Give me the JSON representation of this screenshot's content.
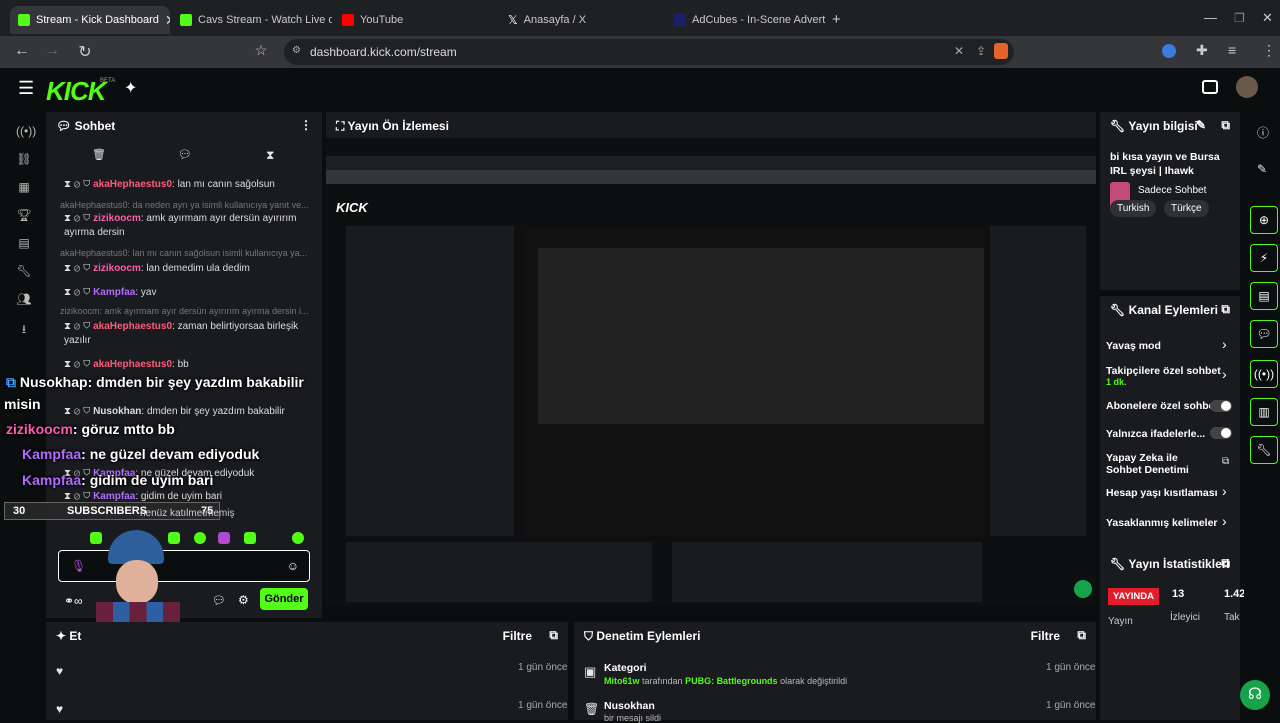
{
  "browser": {
    "tabs": [
      {
        "title": "Stream - Kick Dashboard",
        "color": "#53fc18"
      },
      {
        "title": "Cavs Stream - Watch Live on Kick",
        "color": "#53fc18"
      },
      {
        "title": "YouTube",
        "color": "#ff0000"
      },
      {
        "title": "Anasayfa / X",
        "color": "#ffffff"
      },
      {
        "title": "AdCubes - In-Scene Advertising Platf",
        "color": "#3b4cff"
      }
    ],
    "url": "dashboard.kick.com/stream"
  },
  "kick": {
    "logo": "KICK",
    "beta": "BETA"
  },
  "chat": {
    "title": "Sohbet",
    "messages": [
      {
        "user": "akaHephaestus0",
        "text": ": lan mı canın sağolsun",
        "color": "#ff5b7a"
      },
      {
        "reply": "akaHephaestus0: da neden ayrı ya isimli kullanıcıya yanıt ve..."
      },
      {
        "user": "zizikoocm",
        "text": ": amk ayırmam ayır dersün ayırırım ayırma dersin",
        "color": "#ff5bb0"
      },
      {
        "reply": "akaHephaestus0: lan mı canın sağolsun isimli kullanıcıya ya..."
      },
      {
        "user": "zizikoocm",
        "text": ": lan demedim ula dedim",
        "color": "#ff5bb0"
      },
      {
        "user": "Kampfaa",
        "text": ": yav",
        "color": "#b26bff"
      },
      {
        "reply": "zizikoocm: amk ayırmam ayır dersün ayırırım ayırma dersin i..."
      },
      {
        "user": "akaHephaestus0",
        "text": ": zaman belirtiyorsaa birleşik yazılır",
        "color": "#ff5b7a"
      },
      {
        "user": "akaHephaestus0",
        "text": ": bb",
        "color": "#ff5b7a"
      },
      {
        "user": "Nusokhan",
        "text": ": dmden bir şey yazdım bakabilir",
        "color": "#ffffff"
      },
      {
        "user": "Kampfaa",
        "text": ": ne güzel devam ediyoduk",
        "color": "#b26bff"
      },
      {
        "user": "Kampfaa",
        "text": ": gidim de uyim bari",
        "color": "#b26bff"
      }
    ],
    "overlay": [
      {
        "user": "Nusokhap",
        "text": ": dmden bir şey yazdım bakabilir",
        "user_color": "#ffffff"
      },
      {
        "user": "misin",
        "text": "",
        "user_color": "#ffffff"
      },
      {
        "user": "zizikoocm",
        "text": ": göruz mtto bb",
        "user_color": "#ff5bb0"
      },
      {
        "user": "Kampfaa",
        "text": ": ne güzel devam ediyoduk",
        "user_color": "#b26bff"
      },
      {
        "user": "Kampfaa",
        "text": ": gidim de uyim bari",
        "user_color": "#b26bff"
      }
    ],
    "subscribers_count": "30",
    "subscribers_label": "SUBSCRIBERS",
    "subscribers_goal": "75",
    "footer_note": "henüz katılmetmemiş",
    "send": "Gönder"
  },
  "preview": {
    "title": "Yayın Ön İzlemesi"
  },
  "stream_info": {
    "title": "Yayın bilgisi",
    "stream_title": "bi kısa yayın ve Bursa IRL şeysi | Ihawk",
    "category": "Sadece Sohbet",
    "tags": [
      "Turkish",
      "Türkçe"
    ]
  },
  "channel_actions": {
    "title": "Kanal Eylemleri",
    "items": [
      {
        "label": "Yavaş mod",
        "type": "chevron"
      },
      {
        "label": "Takipçilere özel sohbet",
        "sub": "1 dk.",
        "type": "chevron"
      },
      {
        "label": "Abonelere özel sohbet",
        "type": "toggle"
      },
      {
        "label": "Yalnızca ifadelerle...",
        "type": "toggle"
      },
      {
        "label": "Yapay Zeka ile Sohbet Denetimi",
        "type": "external"
      },
      {
        "label": "Hesap yaşı kısıtlaması",
        "type": "chevron"
      },
      {
        "label": "Yasaklanmış kelimeler",
        "type": "chevron"
      }
    ]
  },
  "stats": {
    "title": "Yayın İstatistikleri",
    "live": "YAYINDA",
    "viewers": "13",
    "followers": "1.42",
    "labels": [
      "Yayın",
      "İzleyici",
      "Tak"
    ]
  },
  "events": {
    "title": "Et",
    "filter": "Filtre",
    "times": [
      "1 gün önce",
      "1 gün önce"
    ]
  },
  "moderation": {
    "title": "Denetim Eylemleri",
    "filter": "Filtre",
    "items": [
      {
        "title": "Kategori",
        "user": "Mito61w",
        "mid": " tarafından ",
        "cat": "PUBG: Battlegrounds",
        "end": " olarak değiştirildi",
        "time": "1 gün önce"
      },
      {
        "title": "Nusokhan",
        "user": "",
        "mid": "bir mesajı sildi",
        "cat": "",
        "end": "",
        "time": "1 gün önce"
      }
    ]
  }
}
